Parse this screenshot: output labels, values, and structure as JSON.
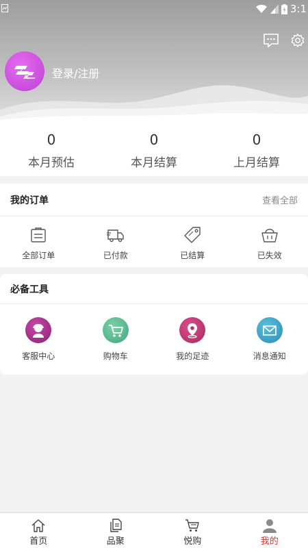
{
  "status_bar": {
    "time": "3:1"
  },
  "profile": {
    "login_label": "登录/注册"
  },
  "stats": [
    {
      "value": "0",
      "label": "本月预估"
    },
    {
      "value": "0",
      "label": "本月结算"
    },
    {
      "value": "0",
      "label": "上月结算"
    }
  ],
  "orders": {
    "title": "我的订单",
    "view_all": "查看全部",
    "items": [
      {
        "label": "全部订单",
        "icon": "clipboard-icon"
      },
      {
        "label": "已付款",
        "icon": "truck-icon"
      },
      {
        "label": "已结算",
        "icon": "tag-icon"
      },
      {
        "label": "已失效",
        "icon": "basket-icon"
      }
    ]
  },
  "tools": {
    "title": "必备工具",
    "items": [
      {
        "label": "客服中心",
        "icon": "customer-service-icon",
        "color": "#a52a8f"
      },
      {
        "label": "购物车",
        "icon": "cart-icon",
        "color": "#4fb88c"
      },
      {
        "label": "我的足迹",
        "icon": "location-pin-icon",
        "color": "#c23a8a"
      },
      {
        "label": "消息通知",
        "icon": "envelope-icon",
        "color": "#3ba3c8"
      }
    ]
  },
  "tabbar": {
    "items": [
      {
        "label": "首页",
        "icon": "home-icon"
      },
      {
        "label": "品聚",
        "icon": "files-icon"
      },
      {
        "label": "悦购",
        "icon": "cart-icon"
      },
      {
        "label": "我的",
        "icon": "user-icon",
        "active": true
      }
    ]
  },
  "colors": {
    "accent": "#d9302c",
    "avatar": "#d455e3"
  }
}
